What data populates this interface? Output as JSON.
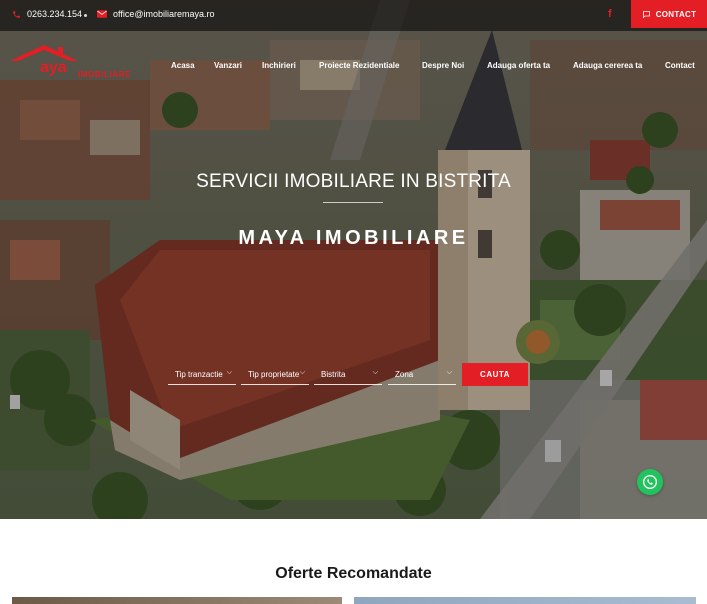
{
  "topbar": {
    "phone": "0263.234.154",
    "email": "office@imobiliaremaya.ro",
    "facebook_label": "f",
    "contact_label": "CONTACT"
  },
  "logo": {
    "wordmark": "aya",
    "subtitle": "IMOBILIARE"
  },
  "nav": {
    "items": [
      {
        "label": "Acasa"
      },
      {
        "label": "Vanzari"
      },
      {
        "label": "Inchirieri"
      },
      {
        "label": "Proiecte Rezidentiale"
      },
      {
        "label": "Despre Noi"
      },
      {
        "label": "Adauga oferta ta"
      },
      {
        "label": "Adauga cererea ta"
      },
      {
        "label": "Contact"
      }
    ]
  },
  "hero": {
    "title": "SERVICII IMOBILIARE IN BISTRITA",
    "brand": "MAYA IMOBILIARE"
  },
  "search": {
    "fields": [
      {
        "label": "Tip tranzactie"
      },
      {
        "label": "Tip proprietate"
      },
      {
        "label": "Bistrita"
      },
      {
        "label": "Zona"
      }
    ],
    "button_label": "CAUTA"
  },
  "section": {
    "title": "Oferte Recomandate"
  },
  "colors": {
    "accent": "#e31e24",
    "whatsapp": "#22c35e"
  }
}
